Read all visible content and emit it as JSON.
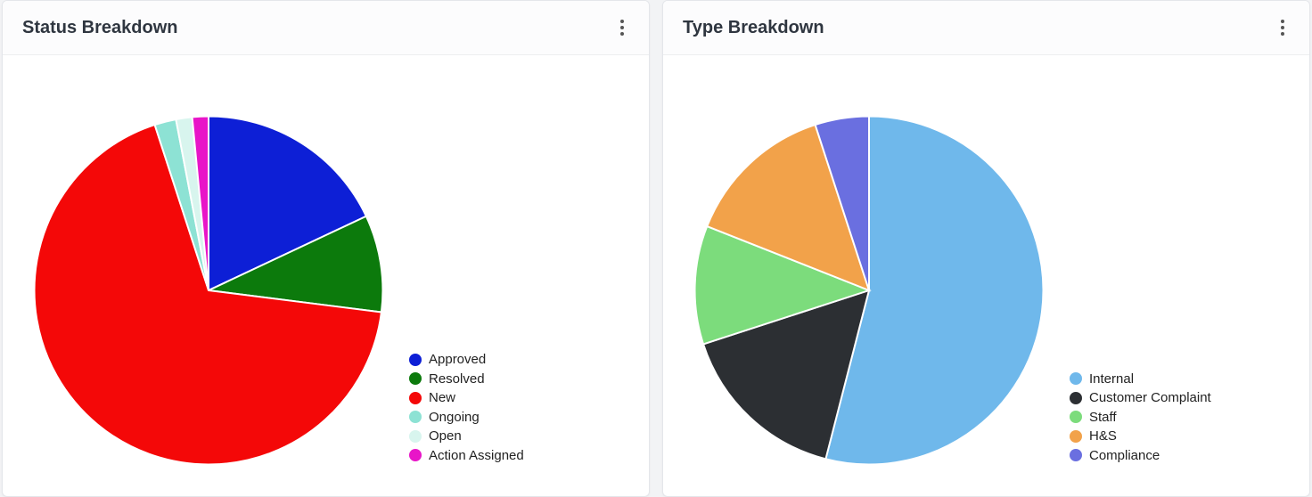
{
  "cards": [
    {
      "id": "status",
      "title": "Status Breakdown",
      "chart_data": {
        "type": "pie",
        "series": [
          {
            "name": "Approved",
            "value": 18,
            "color": "#0d1fd6"
          },
          {
            "name": "Resolved",
            "value": 9,
            "color": "#0c7a0c"
          },
          {
            "name": "New",
            "value": 68,
            "color": "#f40808"
          },
          {
            "name": "Ongoing",
            "value": 2,
            "color": "#8de2d4"
          },
          {
            "name": "Open",
            "value": 1.5,
            "color": "#d8f5ee"
          },
          {
            "name": "Action Assigned",
            "value": 1.5,
            "color": "#e815c8"
          }
        ]
      }
    },
    {
      "id": "type",
      "title": "Type Breakdown",
      "chart_data": {
        "type": "pie",
        "series": [
          {
            "name": "Internal",
            "value": 54,
            "color": "#6fb8eb"
          },
          {
            "name": "Customer Complaint",
            "value": 16,
            "color": "#2c2f33"
          },
          {
            "name": "Staff",
            "value": 11,
            "color": "#7cdc7c"
          },
          {
            "name": "H&S",
            "value": 14,
            "color": "#f2a24a"
          },
          {
            "name": "Compliance",
            "value": 5,
            "color": "#6a6fe0"
          }
        ]
      }
    }
  ],
  "chart_data": [
    {
      "type": "pie",
      "title": "Status Breakdown",
      "categories": [
        "Approved",
        "Resolved",
        "New",
        "Ongoing",
        "Open",
        "Action Assigned"
      ],
      "values": [
        18,
        9,
        68,
        2,
        1.5,
        1.5
      ]
    },
    {
      "type": "pie",
      "title": "Type Breakdown",
      "categories": [
        "Internal",
        "Customer Complaint",
        "Staff",
        "H&S",
        "Compliance"
      ],
      "values": [
        54,
        16,
        11,
        14,
        5
      ]
    }
  ]
}
